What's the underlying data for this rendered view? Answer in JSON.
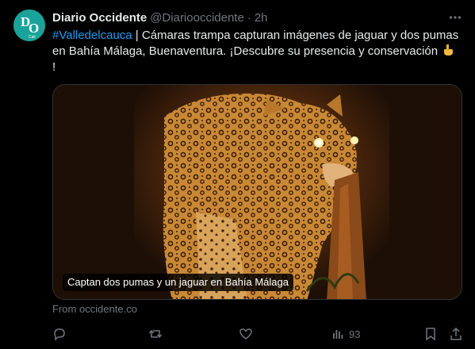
{
  "tweet": {
    "author_name": "Diario Occidente",
    "handle": "@Diariooccidente",
    "separator": "·",
    "time": "2h",
    "hashtag": "#Valledelcauca",
    "body_main": " | Cámaras trampa capturan imágenes de jaguar y dos pumas en Bahía Málaga, Buenaventura. ¡Descubre su presencia y conservación ",
    "body_end": " !",
    "emoji_icon": "point-down-icon",
    "avatar_letters": "DO",
    "avatar_sub": "Cali",
    "media_caption": "Captan dos pumas y un jaguar en Bahía Málaga",
    "link_source": "From occidente.co",
    "views_count": "93"
  },
  "colors": {
    "background": "#000000",
    "accent": "#1d9bf0",
    "muted": "#71767b",
    "avatar_bg": "#1aa39a"
  },
  "icons": [
    "more-icon",
    "reply-icon",
    "retweet-icon",
    "like-icon",
    "views-icon",
    "bookmark-icon",
    "share-icon"
  ]
}
